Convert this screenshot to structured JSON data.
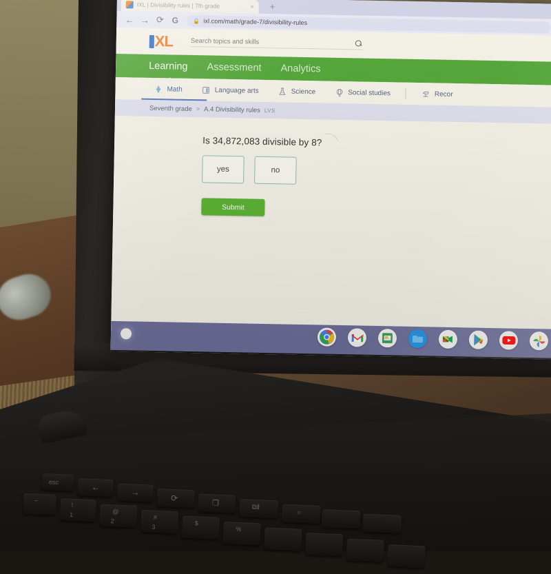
{
  "scene": {
    "description": "Photo of a Chromebook laptop screen showing an IXL math question",
    "device": "chromebook"
  },
  "browser": {
    "tab": {
      "title": "IXL | Divisibility rules | 7th grade",
      "close_label": "×",
      "favicon_name": "ixl-favicon"
    },
    "new_tab_label": "+",
    "nav": {
      "back": "←",
      "forward": "→",
      "reload": "⟳",
      "google": "G"
    },
    "omnibox": {
      "lock": "🔒",
      "url": "ixl.com/math/grade-7/divisibility-rules"
    }
  },
  "ixl": {
    "logo": {
      "letter_i": "I",
      "letters_xl": "XL"
    },
    "search": {
      "placeholder": "Search topics and skills",
      "icon": "search-icon"
    },
    "main_nav": [
      {
        "label": "Learning",
        "active": true
      },
      {
        "label": "Assessment",
        "active": false
      },
      {
        "label": "Analytics",
        "active": false
      }
    ],
    "subject_tabs": [
      {
        "label": "Math",
        "icon": "math-icon",
        "active": true
      },
      {
        "label": "Language arts",
        "icon": "book-icon",
        "active": false
      },
      {
        "label": "Science",
        "icon": "flask-icon",
        "active": false
      },
      {
        "label": "Social studies",
        "icon": "globe-icon",
        "active": false
      },
      {
        "label": "Recommendations",
        "icon": "recommendations-icon",
        "active": false,
        "truncated": "Recor"
      }
    ],
    "breadcrumb": {
      "grade": "Seventh grade",
      "separator": ">",
      "skill": "A.4 Divisibility rules",
      "tag": "LVS"
    },
    "question": {
      "text": "Is 34,872,083 divisible by 8?",
      "choices": [
        {
          "label": "yes",
          "selected": false
        },
        {
          "label": "no",
          "selected": false
        }
      ],
      "submit_label": "Submit"
    }
  },
  "shelf": {
    "launcher_name": "launcher-button",
    "icons": [
      {
        "name": "chrome-icon",
        "label": "Chrome"
      },
      {
        "name": "gmail-icon",
        "label": "Gmail"
      },
      {
        "name": "slides-icon",
        "label": "Slides"
      },
      {
        "name": "files-icon",
        "label": "Files"
      },
      {
        "name": "meet-icon",
        "label": "Meet"
      },
      {
        "name": "play-store-icon",
        "label": "Play Store"
      },
      {
        "name": "youtube-icon",
        "label": "YouTube"
      },
      {
        "name": "photos-icon",
        "label": "Photos"
      }
    ]
  },
  "keyboard": {
    "keys": [
      {
        "label": "esc",
        "name": "escape-key"
      },
      {
        "label": "←",
        "name": "back-key"
      },
      {
        "label": "→",
        "name": "forward-key"
      },
      {
        "label": "⟳",
        "name": "refresh-key"
      },
      {
        "label": "❐",
        "name": "fullscreen-key"
      },
      {
        "label": "⧉‖",
        "name": "overview-key"
      },
      {
        "label": "○",
        "name": "brightness-key"
      },
      {
        "label": "~",
        "name": "tilde-key"
      },
      {
        "label": "!",
        "name": "one-key-shift"
      },
      {
        "label": "1",
        "name": "one-key"
      },
      {
        "label": "@",
        "name": "two-key-shift"
      },
      {
        "label": "2",
        "name": "two-key"
      },
      {
        "label": "#",
        "name": "three-key-shift"
      },
      {
        "label": "3",
        "name": "three-key"
      },
      {
        "label": "$",
        "name": "four-key-shift"
      },
      {
        "label": "%",
        "name": "five-key-shift"
      }
    ]
  },
  "colors": {
    "ixl_green": "#4aa32f",
    "submit_green": "#5cb434",
    "ixl_orange": "#ef7e22",
    "ixl_blue": "#2f6fc6",
    "choice_border": "#89bdbc",
    "shelf": "#6d6f9b",
    "page_bg": "#f6f3e9",
    "breadcrumb_bg": "#dfe0ee"
  }
}
